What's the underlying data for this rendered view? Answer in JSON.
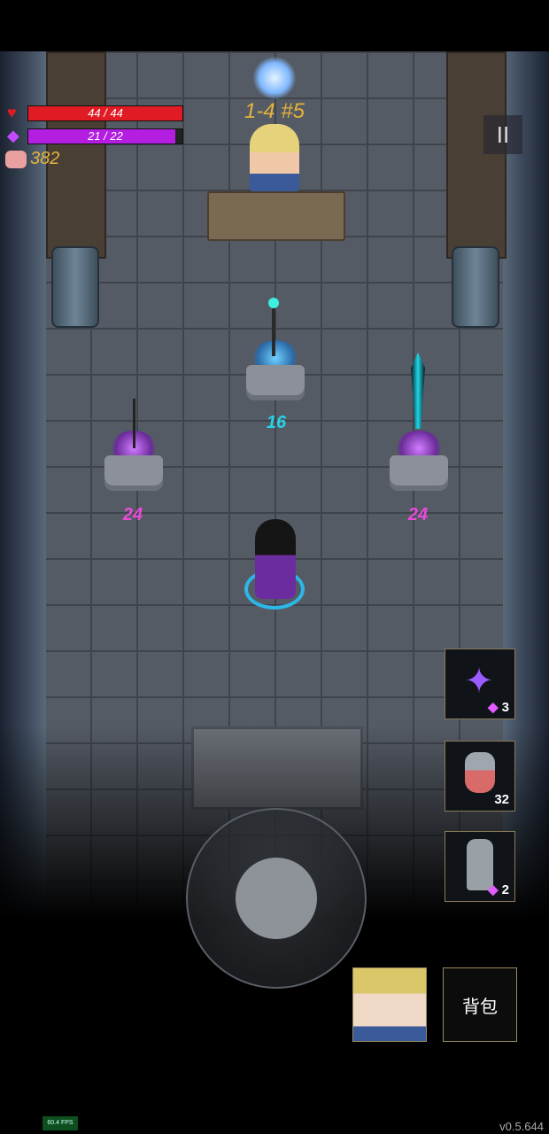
{
  "hud": {
    "hp_text": "44 / 44",
    "hp_fraction": 1.0,
    "mp_text": "21 / 22",
    "mp_fraction": 0.9545,
    "gold": "382",
    "level": "1-4 #5"
  },
  "shop_items": [
    {
      "price": "16",
      "color": "#26d3e6",
      "glow": "blue"
    },
    {
      "price": "24",
      "color": "#e94ad9",
      "glow": "purple"
    },
    {
      "price": "24",
      "color": "#e94ad9",
      "glow": "purple"
    }
  ],
  "quick_slots": [
    {
      "name": "shuriken",
      "count": "3",
      "gem": true
    },
    {
      "name": "potion",
      "count": "32",
      "gem": false
    },
    {
      "name": "statue",
      "count": "2",
      "gem": true
    }
  ],
  "bag_label": "背包",
  "fps": "60.4 FPS",
  "version": "v0.5.644",
  "colors": {
    "hp": "#e01b24",
    "mp": "#b31ee0",
    "gold": "#e6b23a"
  }
}
